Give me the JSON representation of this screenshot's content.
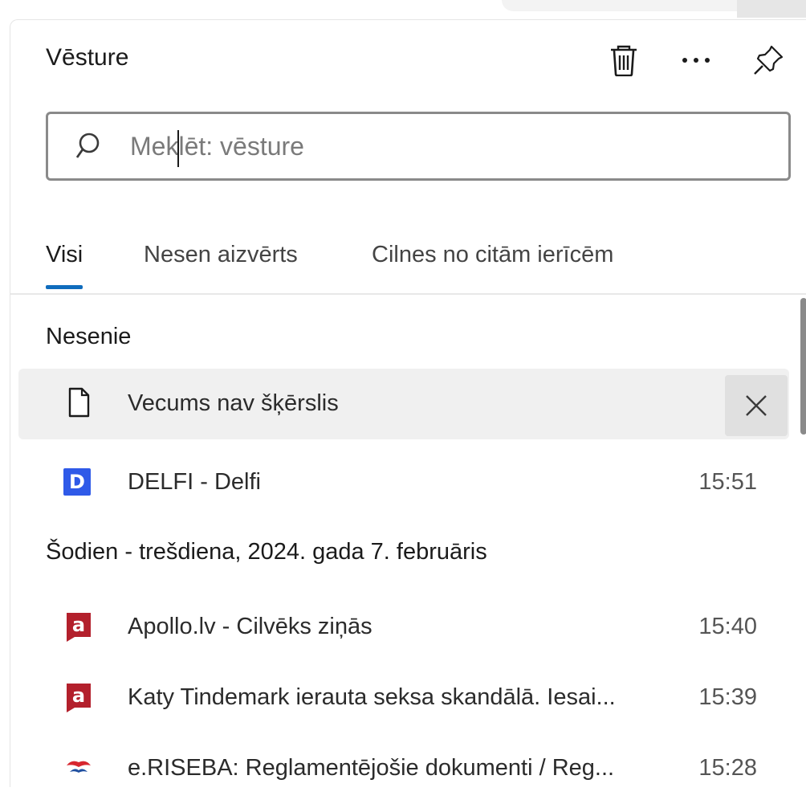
{
  "panel": {
    "title": "Vēsture",
    "actions": {
      "trash": "trash-icon",
      "more": "more-icon",
      "pin": "pin-icon"
    }
  },
  "search": {
    "placeholder": "Meklēt: vēsture",
    "value": ""
  },
  "tabs": [
    {
      "label": "Visi",
      "active": true
    },
    {
      "label": "Nesen aizvērts",
      "active": false
    },
    {
      "label": "Cilnes no citām ierīcēm",
      "active": false
    }
  ],
  "sections": {
    "recent": {
      "heading": "Nesenie",
      "items": [
        {
          "title": "Vecums nav šķērslis",
          "time": "",
          "icon": "document-icon",
          "hovered": true
        },
        {
          "title": "DELFI - Delfi",
          "time": "15:51",
          "icon": "delfi-favicon",
          "favicon_text": "D"
        }
      ]
    },
    "today": {
      "heading": "Šodien - trešdiena, 2024. gada 7. februāris",
      "items": [
        {
          "title": "Apollo.lv - Cilvēks ziņās",
          "time": "15:40",
          "icon": "apollo-favicon",
          "favicon_text": "a"
        },
        {
          "title": "Katy Tindemark ierauta seksa skandālā. Iesai...",
          "time": "15:39",
          "icon": "apollo-favicon",
          "favicon_text": "a"
        },
        {
          "title": "e.RISEBA: Reglamentējošie dokumenti / Reg...",
          "time": "15:28",
          "icon": "riseba-favicon"
        }
      ]
    }
  },
  "colors": {
    "accent": "#0f6cbd",
    "delfi": "#2f5ae8",
    "apollo": "#b3202c",
    "riseba": "#d7262f"
  }
}
